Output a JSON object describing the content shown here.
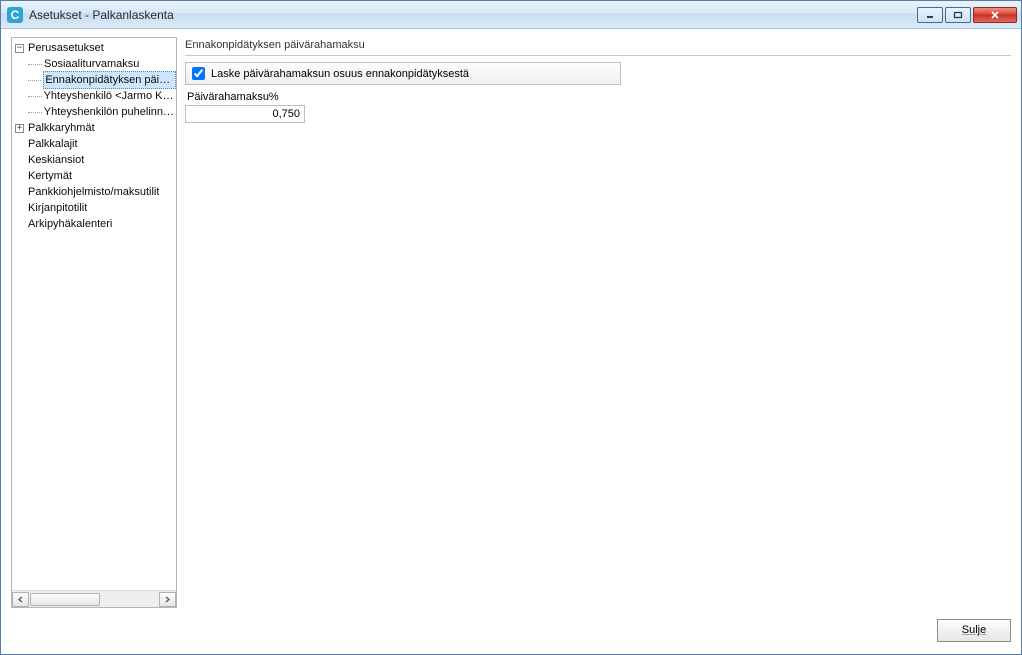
{
  "window": {
    "title": "Asetukset - Palkanlaskenta",
    "app_icon_letter": "C"
  },
  "tree": {
    "items": [
      {
        "label": "Perusasetukset",
        "expander": "minus",
        "level": 0
      },
      {
        "label": "Sosiaaliturvamaksu",
        "level": 1
      },
      {
        "label": "Ennakonpidätyksen päivära",
        "level": 1,
        "selected": true
      },
      {
        "label": "Yhteyshenkilö <Jarmo Kähk",
        "level": 1
      },
      {
        "label": "Yhteyshenkilön puhelinnum",
        "level": 1
      },
      {
        "label": "Palkkaryhmät",
        "expander": "plus",
        "level": 0
      },
      {
        "label": "Palkkalajit",
        "level": 0
      },
      {
        "label": "Keskiansiot",
        "level": 0
      },
      {
        "label": "Kertymät",
        "level": 0
      },
      {
        "label": "Pankkiohjelmisto/maksutilit",
        "level": 0
      },
      {
        "label": "Kirjanpitotilit",
        "level": 0
      },
      {
        "label": "Arkipyhäkalenteri",
        "level": 0
      }
    ]
  },
  "main": {
    "heading": "Ennakonpidätyksen päivärahamaksu",
    "checkbox_label": "Laske päivärahamaksun osuus ennakonpidätyksestä",
    "checkbox_checked": true,
    "field_label": "Päivärahamaksu%",
    "field_value": "0,750"
  },
  "footer": {
    "close_label": "Sulje"
  }
}
